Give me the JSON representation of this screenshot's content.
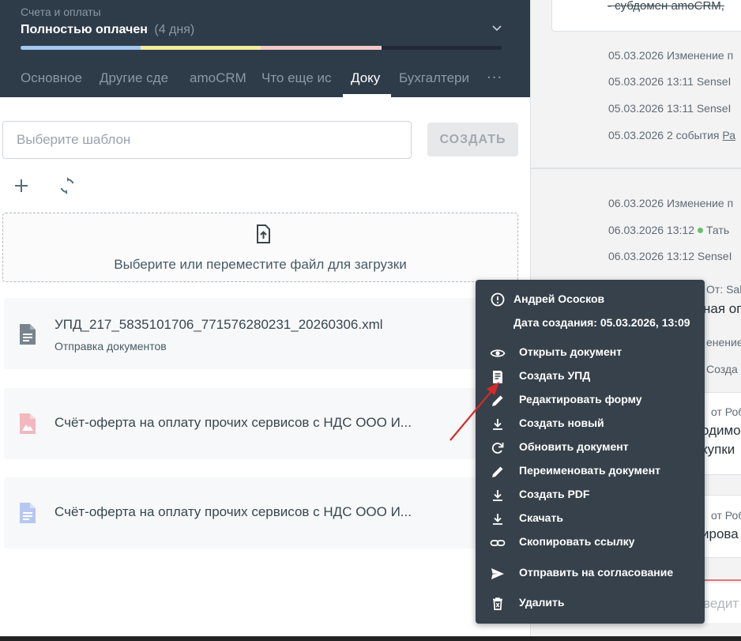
{
  "header": {
    "pipeline": "Счета и оплаты",
    "status": "Полностью оплачен",
    "status_days": "(4 дня)",
    "progress_colors": [
      "#a4c8f0",
      "#f4ec9c",
      "#f5c9c6"
    ]
  },
  "tabs": [
    {
      "label": "Основное"
    },
    {
      "label": "Другие сде"
    },
    {
      "label": "amoCRM"
    },
    {
      "label": "Что еще ис"
    },
    {
      "label": "Доку"
    },
    {
      "label": "Бухгалтери"
    }
  ],
  "tabs_more": "···",
  "template": {
    "placeholder": "Выберите шаблон",
    "create_label": "СОЗДАТЬ"
  },
  "upload": {
    "text": "Выберите или переместите файл для загрузки"
  },
  "documents": [
    {
      "name": "УПД_217_5835101706_771576280231_20260306.xml",
      "subtitle": "Отправка документов",
      "icon": "file-document-icon",
      "color": "#78848d"
    },
    {
      "name": "Счёт-оферта на оплату прочих сервисов с НДС ООО И...",
      "subtitle": "",
      "icon": "file-pdf-icon",
      "color": "#f2b8bf"
    },
    {
      "name": "Счёт-оферта на оплату прочих сервисов с НДС ООО И...",
      "subtitle": "",
      "icon": "file-doc-icon",
      "color": "#b7c8f0"
    }
  ],
  "feed": {
    "card_text": "- субдомен amoCRM,",
    "lines_a": [
      "05.03.2026 Изменение п",
      "05.03.2026 13:11 SenseI",
      "05.03.2026 13:11 SenseI"
    ],
    "line_events_prefix": "05.03.2026 2 события ",
    "line_events_link": "Ра",
    "lines_b": [
      "06.03.2026 Изменение п"
    ],
    "line_user_prefix": "06.03.2026 13:12",
    "line_user_name": "Тать",
    "line_sense": "06.03.2026 13:12 SenseI",
    "from_sa": "От: Sal",
    "op_text": "ная оп",
    "change_text": "енение п",
    "create_text": "Созда",
    "from_rob_1": "от Роб",
    "needed_text": "одимо",
    "purchases_text": "купки",
    "from_rob_2": "от Роб",
    "rova_text": "ирова",
    "input_text": "ведит"
  },
  "menu": {
    "author": "Андрей Ососков",
    "created": "Дата создания: 05.03.2026, 13:09",
    "items": [
      {
        "label": "Открыть документ",
        "icon": "eye-icon"
      },
      {
        "label": "Создать УПД",
        "icon": "document-form-icon"
      },
      {
        "label": "Редактировать форму",
        "icon": "pencil-icon"
      },
      {
        "label": "Создать новый",
        "icon": "download-icon"
      },
      {
        "label": "Обновить документ",
        "icon": "refresh-icon"
      },
      {
        "label": "Переименовать документ",
        "icon": "pencil-icon"
      },
      {
        "label": "Создать PDF",
        "icon": "download-icon"
      },
      {
        "label": "Скачать",
        "icon": "download-icon"
      },
      {
        "label": "Скопировать ссылку",
        "icon": "link-icon"
      },
      {
        "label": "Отправить на согласование",
        "icon": "send-icon"
      },
      {
        "label": "Удалить",
        "icon": "trash-icon"
      }
    ]
  }
}
